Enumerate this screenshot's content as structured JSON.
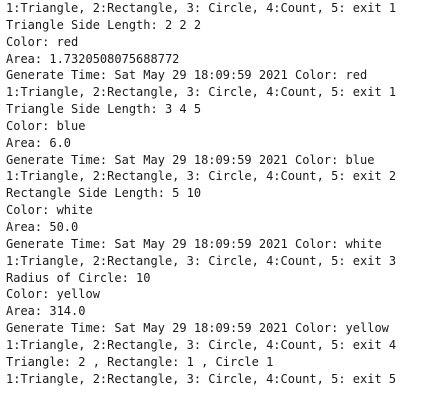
{
  "console": {
    "lines": [
      "1:Triangle, 2:Rectangle, 3: Circle, 4:Count, 5: exit 1",
      "Triangle Side Length: 2 2 2",
      "Color: red",
      "Area: 1.7320508075688772",
      "Generate Time: Sat May 29 18:09:59 2021 Color: red",
      "1:Triangle, 2:Rectangle, 3: Circle, 4:Count, 5: exit 1",
      "Triangle Side Length: 3 4 5",
      "Color: blue",
      "Area: 6.0",
      "Generate Time: Sat May 29 18:09:59 2021 Color: blue",
      "1:Triangle, 2:Rectangle, 3: Circle, 4:Count, 5: exit 2",
      "Rectangle Side Length: 5 10",
      "Color: white",
      "Area: 50.0",
      "Generate Time: Sat May 29 18:09:59 2021 Color: white",
      "1:Triangle, 2:Rectangle, 3: Circle, 4:Count, 5: exit 3",
      "Radius of Circle: 10",
      "Color: yellow",
      "Area: 314.0",
      "Generate Time: Sat May 29 18:09:59 2021 Color: yellow",
      "1:Triangle, 2:Rectangle, 3: Circle, 4:Count, 5: exit 4",
      "Triangle: 2 , Rectangle: 1 , Circle 1",
      "1:Triangle, 2:Rectangle, 3: Circle, 4:Count, 5: exit 5"
    ]
  }
}
